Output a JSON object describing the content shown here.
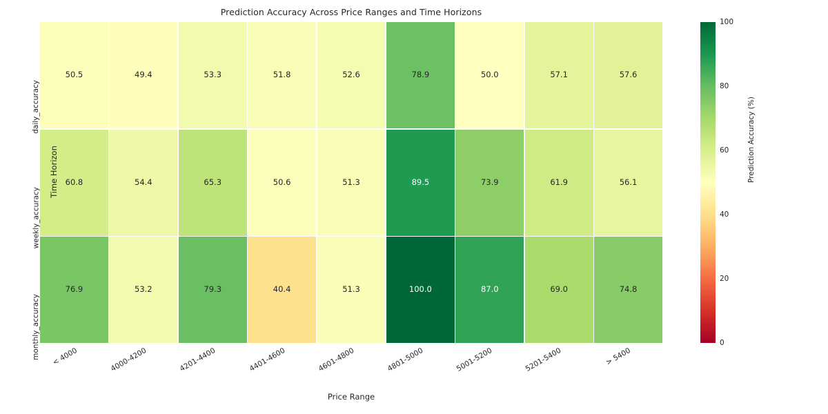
{
  "chart_data": {
    "type": "heatmap",
    "title": "Prediction Accuracy Across Price Ranges and Time Horizons",
    "xlabel": "Price Range",
    "ylabel": "Time Horizon",
    "categories": [
      "< 4000",
      "4000-4200",
      "4201-4400",
      "4401-4600",
      "4601-4800",
      "4801-5000",
      "5001-5200",
      "5201-5400",
      "> 5400"
    ],
    "rows": [
      "daily_accuracy",
      "weekly_accuracy",
      "monthly_accuracy"
    ],
    "values": [
      [
        50.5,
        49.4,
        53.3,
        51.8,
        52.6,
        78.9,
        50.0,
        57.1,
        57.6
      ],
      [
        60.8,
        54.4,
        65.3,
        50.6,
        51.3,
        89.5,
        73.9,
        61.9,
        56.1
      ],
      [
        76.9,
        53.2,
        79.3,
        40.4,
        51.3,
        100.0,
        87.0,
        69.0,
        74.8
      ]
    ],
    "annotations": [
      [
        "50.5",
        "49.4",
        "53.3",
        "51.8",
        "52.6",
        "78.9",
        "50.0",
        "57.1",
        "57.6"
      ],
      [
        "60.8",
        "54.4",
        "65.3",
        "50.6",
        "51.3",
        "89.5",
        "73.9",
        "61.9",
        "56.1"
      ],
      [
        "76.9",
        "53.2",
        "79.3",
        "40.4",
        "51.3",
        "100.0",
        "87.0",
        "69.0",
        "74.8"
      ]
    ],
    "colormap": "RdYlGn",
    "colorbar": {
      "label": "Prediction Accuracy (%)",
      "ticks": [
        0,
        20,
        40,
        60,
        80,
        100
      ],
      "tick_labels": [
        "0",
        "20",
        "40",
        "60",
        "80",
        "100"
      ],
      "vmin": 0,
      "vmax": 100,
      "position": "right"
    },
    "grid": false,
    "legend": "none",
    "colors": {
      "vmax_color": "#006837",
      "vmid_color": "#ffffbf",
      "vmin_color": "#a50026",
      "text_dark": "#262626",
      "text_light": "#ffffff",
      "background": "#ffffff"
    }
  }
}
